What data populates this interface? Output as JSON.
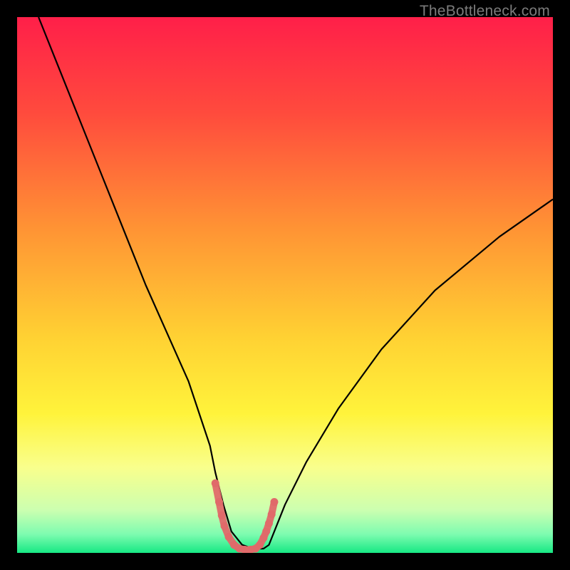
{
  "watermark": "TheBottleneck.com",
  "chart_data": {
    "type": "line",
    "title": "",
    "xlabel": "",
    "ylabel": "",
    "xlim": [
      0,
      100
    ],
    "ylim": [
      0,
      100
    ],
    "grid": false,
    "legend": false,
    "background_gradient_stops": [
      {
        "offset": 0.0,
        "color": "#ff1f49"
      },
      {
        "offset": 0.18,
        "color": "#ff4b3d"
      },
      {
        "offset": 0.4,
        "color": "#ff9534"
      },
      {
        "offset": 0.6,
        "color": "#ffd233"
      },
      {
        "offset": 0.74,
        "color": "#fff33b"
      },
      {
        "offset": 0.84,
        "color": "#f9ff8c"
      },
      {
        "offset": 0.92,
        "color": "#ccffb0"
      },
      {
        "offset": 0.965,
        "color": "#7efcb0"
      },
      {
        "offset": 1.0,
        "color": "#17e884"
      }
    ],
    "series": [
      {
        "name": "bottleneck-curve",
        "stroke": "#000000",
        "stroke_width": 2.2,
        "x": [
          4,
          8,
          12,
          16,
          20,
          24,
          28,
          32,
          34,
          36,
          37,
          38.5,
          40,
          42,
          44,
          46,
          47,
          48,
          50,
          54,
          60,
          68,
          78,
          90,
          100
        ],
        "y": [
          100,
          90,
          80,
          70,
          60,
          50,
          41,
          32,
          26,
          20,
          15,
          9,
          4,
          1.5,
          0.8,
          0.8,
          1.5,
          4,
          9,
          17,
          27,
          38,
          49,
          59,
          66
        ]
      },
      {
        "name": "valley-marker",
        "stroke": "#e06a6a",
        "stroke_width": 10,
        "linecap": "round",
        "x": [
          37.0,
          37.7,
          38.2,
          38.7,
          39.5,
          40.5,
          41.5,
          42.5,
          43.5,
          44.5,
          45.3,
          46.0,
          46.5,
          47.0,
          47.5,
          48.0
        ],
        "y": [
          13.0,
          9.5,
          7.0,
          5.0,
          3.0,
          1.5,
          0.8,
          0.6,
          0.6,
          0.8,
          1.5,
          2.8,
          4.0,
          5.5,
          7.2,
          9.5
        ]
      }
    ]
  }
}
